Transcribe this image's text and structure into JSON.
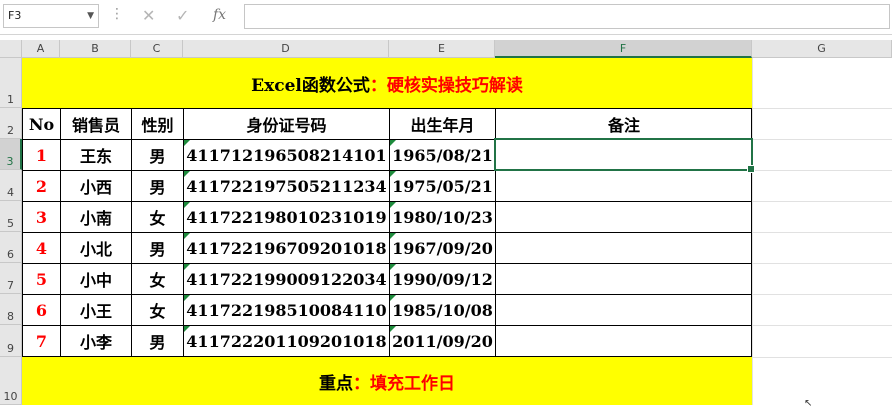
{
  "namebox": {
    "value": "F3",
    "dropdown_icon": "chevron-down-icon"
  },
  "formula_bar": {
    "cancel_icon": "close-icon",
    "enter_icon": "check-icon",
    "fx_label": "fx",
    "value": ""
  },
  "columns": [
    "A",
    "B",
    "C",
    "D",
    "E",
    "F",
    "G"
  ],
  "rows": [
    "1",
    "2",
    "3",
    "4",
    "5",
    "6",
    "7",
    "8",
    "9",
    "10"
  ],
  "title": {
    "part1": "Excel函数公式",
    "part2": "：硬核实操技巧解读"
  },
  "table": {
    "headers": [
      "No",
      "销售员",
      "性别",
      "身份证号码",
      "出生年月",
      "备注"
    ],
    "rows": [
      {
        "no": "1",
        "name": "王东",
        "gender": "男",
        "id": "41171219650821410​1",
        "birth": "1965/08/21",
        "note": ""
      },
      {
        "no": "2",
        "name": "小西",
        "gender": "男",
        "id": "411722197505211234",
        "birth": "1975/05/21",
        "note": ""
      },
      {
        "no": "3",
        "name": "小南",
        "gender": "女",
        "id": "411722198010231019",
        "birth": "1980/10/23",
        "note": ""
      },
      {
        "no": "4",
        "name": "小北",
        "gender": "男",
        "id": "411722196709201018",
        "birth": "1967/09/20",
        "note": ""
      },
      {
        "no": "5",
        "name": "小中",
        "gender": "女",
        "id": "411722199009122034",
        "birth": "1990/09/12",
        "note": ""
      },
      {
        "no": "6",
        "name": "小王",
        "gender": "女",
        "id": "411722198510084110",
        "birth": "1985/10/08",
        "note": ""
      },
      {
        "no": "7",
        "name": "小李",
        "gender": "男",
        "id": "411722201109201018",
        "birth": "2011/09/20",
        "note": ""
      }
    ]
  },
  "footer": {
    "part1": "重点",
    "part2": "：填充工作日"
  },
  "colors": {
    "band": "#ffff00",
    "accent_red": "#ff0000",
    "selection": "#217346"
  }
}
